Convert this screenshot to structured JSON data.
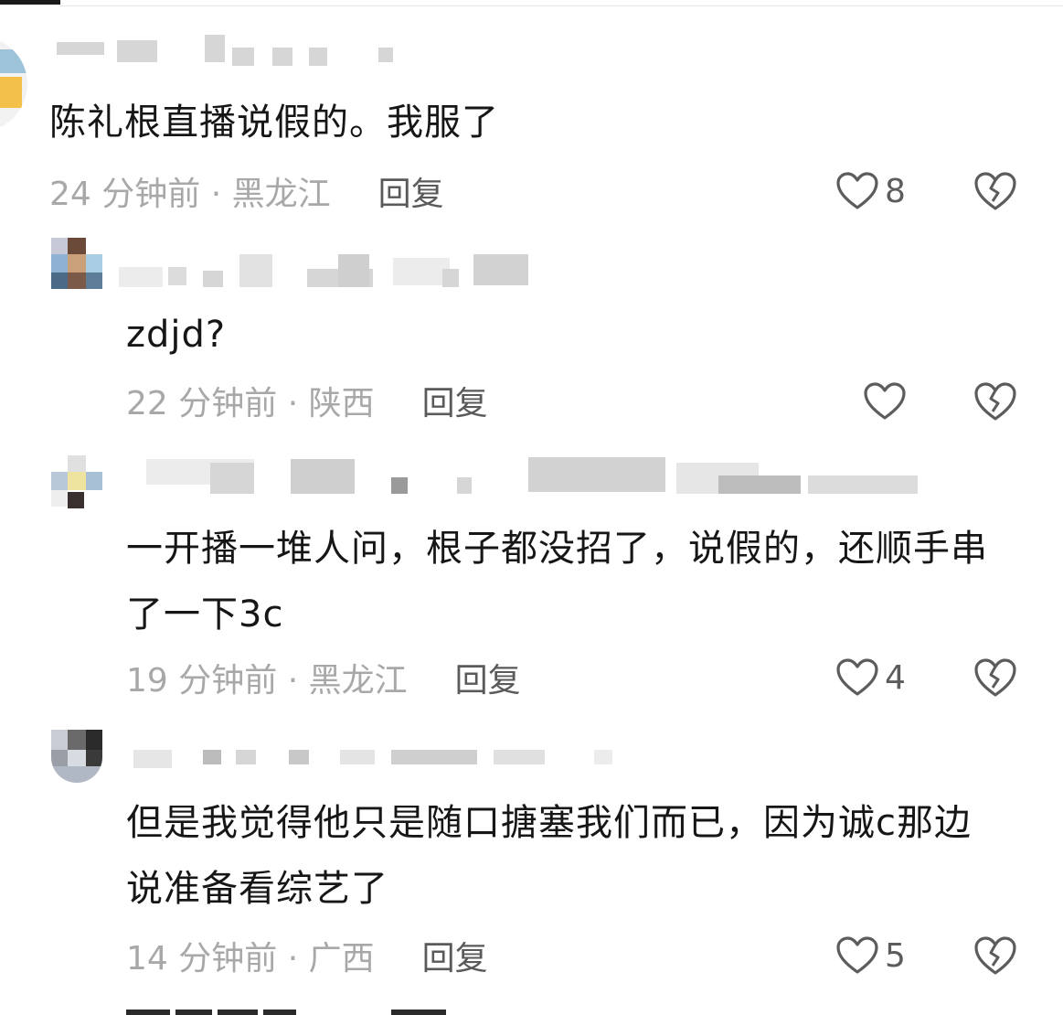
{
  "colors": {
    "text": "#161616",
    "meta": "#a8a8a8",
    "reply": "#5a5a5a",
    "icon": "#5c5c5c"
  },
  "comments": [
    {
      "text": "陈礼根直播说假的。我服了",
      "time": "24 分钟前 · 黑龙江",
      "reply": "回复",
      "likes": "8"
    },
    {
      "text": "zdjd?",
      "time": "22 分钟前 · 陕西",
      "reply": "回复",
      "likes": ""
    },
    {
      "text": "一开播一堆人问，根子都没招了，说假的，还顺手串了一下3c",
      "time": "19 分钟前 · 黑龙江",
      "reply": "回复",
      "likes": "4"
    },
    {
      "text": "但是我觉得他只是随口搪塞我们而已，因为诚c那边说准备看综艺了",
      "time": "14 分钟前 · 广西",
      "reply": "回复",
      "likes": "5"
    }
  ],
  "icons": {
    "like": "heart-outline-icon",
    "dislike": "broken-heart-icon"
  }
}
